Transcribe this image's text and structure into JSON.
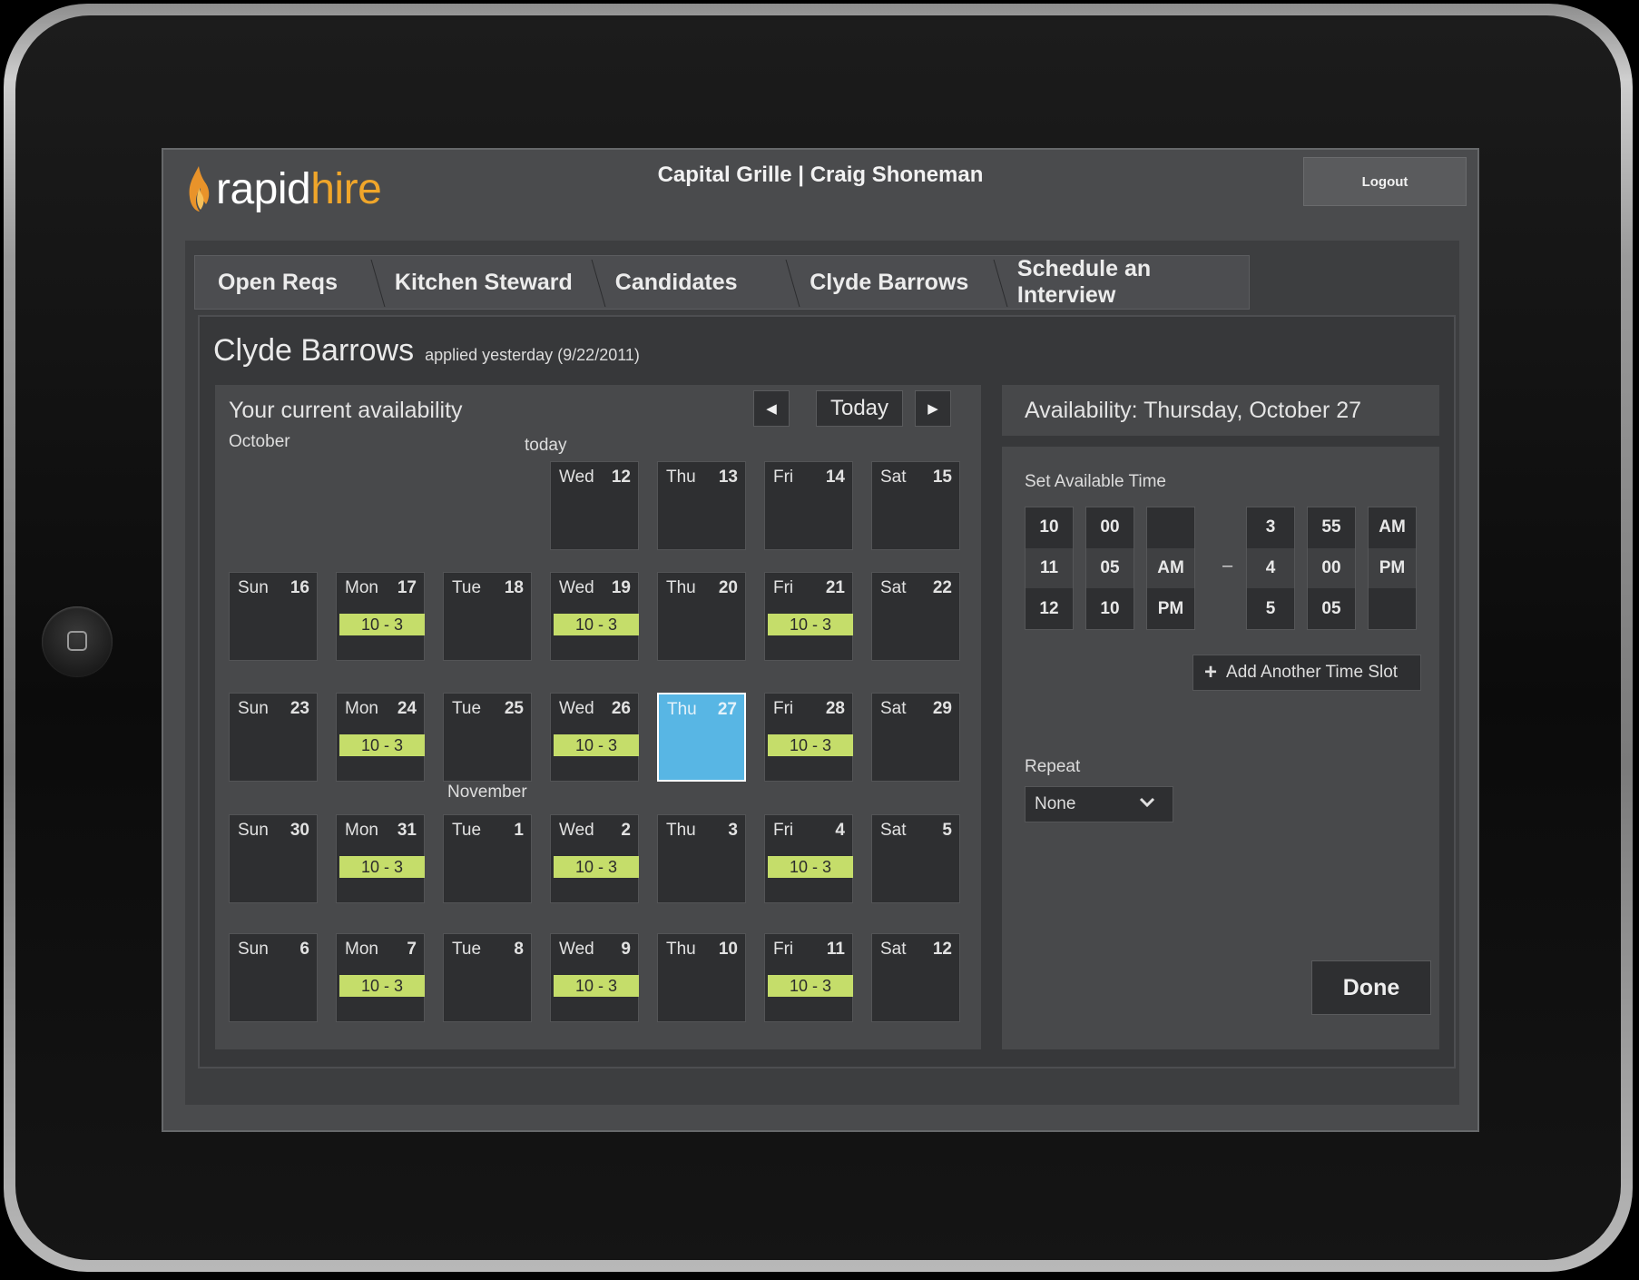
{
  "app": {
    "logo_part1": "rapid",
    "logo_part2": "hire",
    "header_title": "Capital Grille | Craig Shoneman",
    "logout_label": "Logout"
  },
  "breadcrumb": [
    "Open Reqs",
    "Kitchen Steward",
    "Candidates",
    "Clyde Barrows",
    "Schedule an Interview"
  ],
  "candidate": {
    "name": "Clyde Barrows",
    "applied_text": "applied yesterday (9/22/2011)"
  },
  "calendar": {
    "title": "Your current availability",
    "today_button": "Today",
    "today_label": "today",
    "month_labels": [
      "October",
      "November"
    ],
    "weeks": [
      [
        null,
        null,
        null,
        {
          "dow": "Wed",
          "date": "12",
          "slot": ""
        },
        {
          "dow": "Thu",
          "date": "13",
          "slot": ""
        },
        {
          "dow": "Fri",
          "date": "14",
          "slot": ""
        },
        {
          "dow": "Sat",
          "date": "15",
          "slot": ""
        }
      ],
      [
        {
          "dow": "Sun",
          "date": "16",
          "slot": ""
        },
        {
          "dow": "Mon",
          "date": "17",
          "slot": "10 - 3"
        },
        {
          "dow": "Tue",
          "date": "18",
          "slot": ""
        },
        {
          "dow": "Wed",
          "date": "19",
          "slot": "10 - 3"
        },
        {
          "dow": "Thu",
          "date": "20",
          "slot": ""
        },
        {
          "dow": "Fri",
          "date": "21",
          "slot": "10 - 3"
        },
        {
          "dow": "Sat",
          "date": "22",
          "slot": ""
        }
      ],
      [
        {
          "dow": "Sun",
          "date": "23",
          "slot": ""
        },
        {
          "dow": "Mon",
          "date": "24",
          "slot": "10 - 3"
        },
        {
          "dow": "Tue",
          "date": "25",
          "slot": ""
        },
        {
          "dow": "Wed",
          "date": "26",
          "slot": "10 - 3"
        },
        {
          "dow": "Thu",
          "date": "27",
          "slot": "",
          "selected": true
        },
        {
          "dow": "Fri",
          "date": "28",
          "slot": "10 - 3"
        },
        {
          "dow": "Sat",
          "date": "29",
          "slot": ""
        }
      ],
      [
        {
          "dow": "Sun",
          "date": "30",
          "slot": ""
        },
        {
          "dow": "Mon",
          "date": "31",
          "slot": "10 - 3"
        },
        {
          "dow": "Tue",
          "date": "1",
          "slot": ""
        },
        {
          "dow": "Wed",
          "date": "2",
          "slot": "10 - 3"
        },
        {
          "dow": "Thu",
          "date": "3",
          "slot": ""
        },
        {
          "dow": "Fri",
          "date": "4",
          "slot": "10 - 3"
        },
        {
          "dow": "Sat",
          "date": "5",
          "slot": ""
        }
      ],
      [
        {
          "dow": "Sun",
          "date": "6",
          "slot": ""
        },
        {
          "dow": "Mon",
          "date": "7",
          "slot": "10 - 3"
        },
        {
          "dow": "Tue",
          "date": "8",
          "slot": ""
        },
        {
          "dow": "Wed",
          "date": "9",
          "slot": "10 - 3"
        },
        {
          "dow": "Thu",
          "date": "10",
          "slot": ""
        },
        {
          "dow": "Fri",
          "date": "11",
          "slot": "10 - 3"
        },
        {
          "dow": "Sat",
          "date": "12",
          "slot": ""
        }
      ]
    ]
  },
  "availability": {
    "header": "Availability: Thursday, October 27",
    "set_label": "Set Available Time",
    "start": {
      "hour": [
        "10",
        "11",
        "12"
      ],
      "minute": [
        "00",
        "05",
        "10"
      ],
      "ampm": [
        "",
        "AM",
        "PM"
      ]
    },
    "separator": "–",
    "end": {
      "hour": [
        "3",
        "4",
        "5"
      ],
      "minute": [
        "55",
        "00",
        "05"
      ],
      "ampm": [
        "AM",
        "PM",
        ""
      ]
    },
    "add_slot_label": "Add Another Time Slot",
    "repeat_label": "Repeat",
    "repeat_value": "None",
    "done_label": "Done"
  },
  "colors": {
    "accent_orange": "#f0a62a",
    "slot_green": "#c5dd6a",
    "selected_blue": "#58b6e4"
  }
}
